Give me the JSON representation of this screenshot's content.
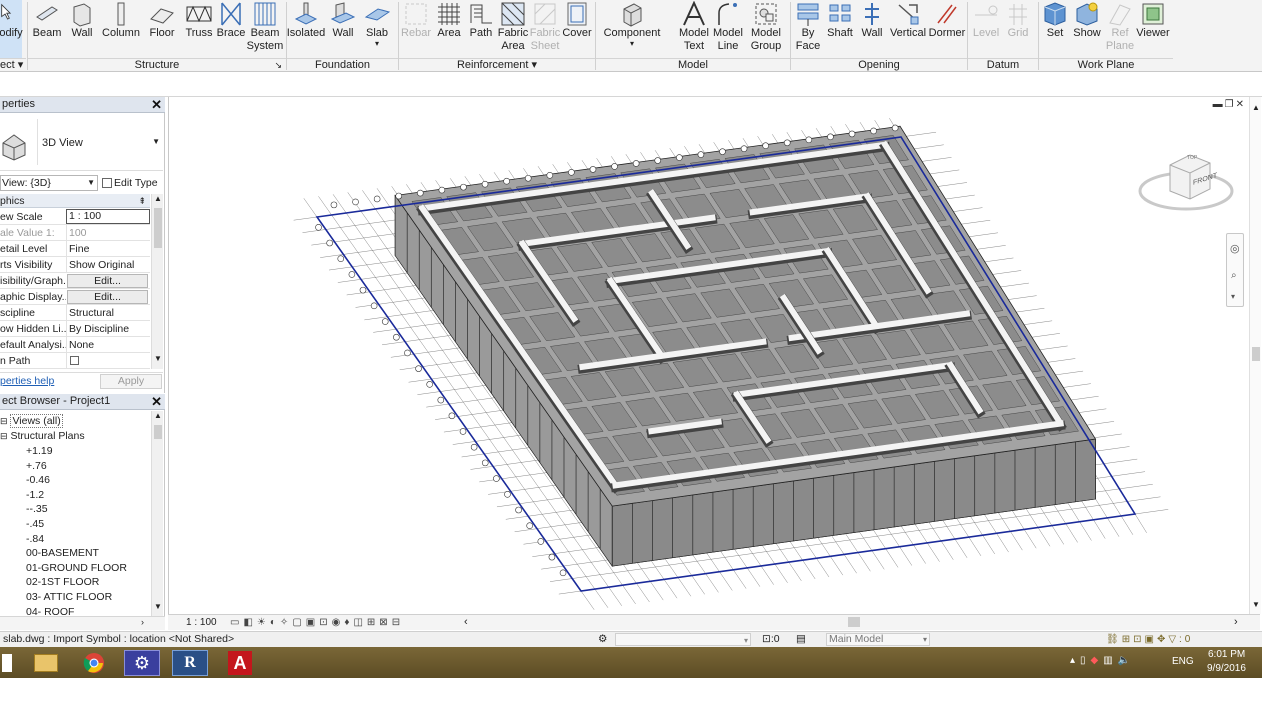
{
  "ribbon": {
    "modify": "odify",
    "select": "ect",
    "structure_buttons": [
      "Beam",
      "Wall",
      "Column",
      "Floor",
      "Truss",
      "Brace"
    ],
    "beam_system": [
      "Beam",
      "System"
    ],
    "foundation_buttons": [
      "Isolated",
      "Wall",
      "Slab"
    ],
    "rebar": "Rebar",
    "reinforcement_buttons": [
      "Area",
      "Path"
    ],
    "fabric_area": [
      "Fabric",
      "Area"
    ],
    "fabric_sheet": [
      "Fabric",
      "Sheet"
    ],
    "cover": "Cover",
    "component": "Component",
    "model_text": [
      "Model",
      "Text"
    ],
    "model_line": [
      "Model",
      "Line"
    ],
    "model_group": [
      "Model",
      "Group"
    ],
    "by_face": [
      "By",
      "Face"
    ],
    "opening_buttons": [
      "Shaft",
      "Wall",
      "Vertical",
      "Dormer"
    ],
    "datum_buttons": [
      "Level",
      "Grid"
    ],
    "work_plane_buttons": [
      "Set",
      "Show"
    ],
    "ref_plane": [
      "Ref",
      "Plane"
    ],
    "viewer": "Viewer",
    "panels": {
      "structure": "Structure",
      "foundation": "Foundation",
      "reinforcement": "Reinforcement",
      "model": "Model",
      "opening": "Opening",
      "datum": "Datum",
      "work_plane": "Work Plane"
    }
  },
  "properties": {
    "title": "perties",
    "type_name": "3D View",
    "view_selector": "View: {3D}",
    "edit_type": "Edit Type",
    "group": "phics",
    "rows": [
      {
        "k": "ew Scale",
        "v": "1 : 100"
      },
      {
        "k": "ale Value   1:",
        "v": "100"
      },
      {
        "k": "etail Level",
        "v": "Fine"
      },
      {
        "k": "rts Visibility",
        "v": "Show Original"
      },
      {
        "k": "isibility/Graph...",
        "v": "Edit..."
      },
      {
        "k": "aphic Display...",
        "v": "Edit..."
      },
      {
        "k": "scipline",
        "v": "Structural"
      },
      {
        "k": "ow Hidden Li...",
        "v": "By Discipline"
      },
      {
        "k": "efault Analysi...",
        "v": "None"
      },
      {
        "k": "n Path",
        "v": ""
      }
    ],
    "help_link": "perties help",
    "apply": "Apply"
  },
  "browser": {
    "title": "ect Browser - Project1",
    "views_root": "Views (all)",
    "structural_plans": "Structural Plans",
    "items": [
      "+1.19",
      "+.76",
      "-0.46",
      "-1.2",
      "--.35",
      "-.45",
      "-.84",
      "00-BASEMENT",
      "01-GROUND FLOOR",
      "02-1ST FLOOR",
      "03- ATTIC FLOOR",
      "04- ROOF"
    ]
  },
  "viewbar": {
    "scale": "1 : 100",
    "ctrl_value": ":0",
    "model": "Main Model",
    "right_value": ":0"
  },
  "status": {
    "message": "slab.dwg : Import Symbol : location <Not Shared>"
  },
  "taskbar": {
    "lang": "ENG",
    "time": "6:01 PM",
    "date": "9/9/2016"
  },
  "viewcube": {
    "face": "FRONT",
    "top": "TOP"
  }
}
